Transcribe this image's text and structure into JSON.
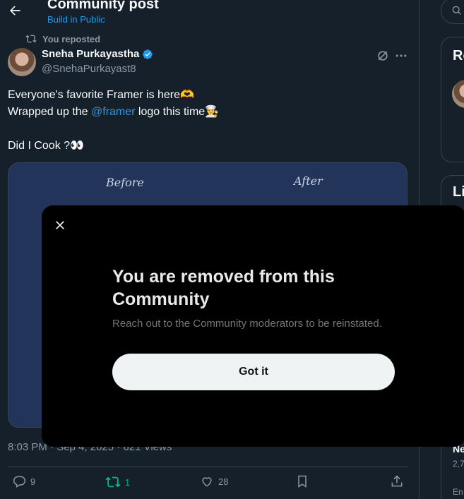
{
  "header": {
    "title": "Community post",
    "subtitle": "Build in Public"
  },
  "post": {
    "repost_label": "You reposted",
    "author_name": "Sneha Purkayastha",
    "author_handle": "@SnehaPurkayast8",
    "text_line1": "Everyone's favorite Framer is here🫶",
    "text_line2_prefix": "Wrapped up the ",
    "text_line2_mention": "@framer",
    "text_line2_suffix": " logo this time👨‍🍳",
    "text_line3": "Did I Cook ?👀",
    "media_label_before": "Before",
    "media_label_after": "After",
    "timestamp": "8:03 PM · Sep 4, 2025 · 621 Views"
  },
  "actions": {
    "replies": "9",
    "reposts": "1",
    "likes": "28"
  },
  "right_sidebar": {
    "card1_title": "Re",
    "card2_title": "Li",
    "item_title": "Ne",
    "item_count": "2,7",
    "item_footer": "En"
  },
  "modal": {
    "title": "You are removed from this Community",
    "description": "Reach out to the Community moderators to be reinstated.",
    "button_label": "Got it"
  },
  "colors": {
    "background": "#15202b",
    "accent": "#1d9bf0",
    "repost_green": "#00ba7c",
    "modal_bg": "#000000"
  }
}
